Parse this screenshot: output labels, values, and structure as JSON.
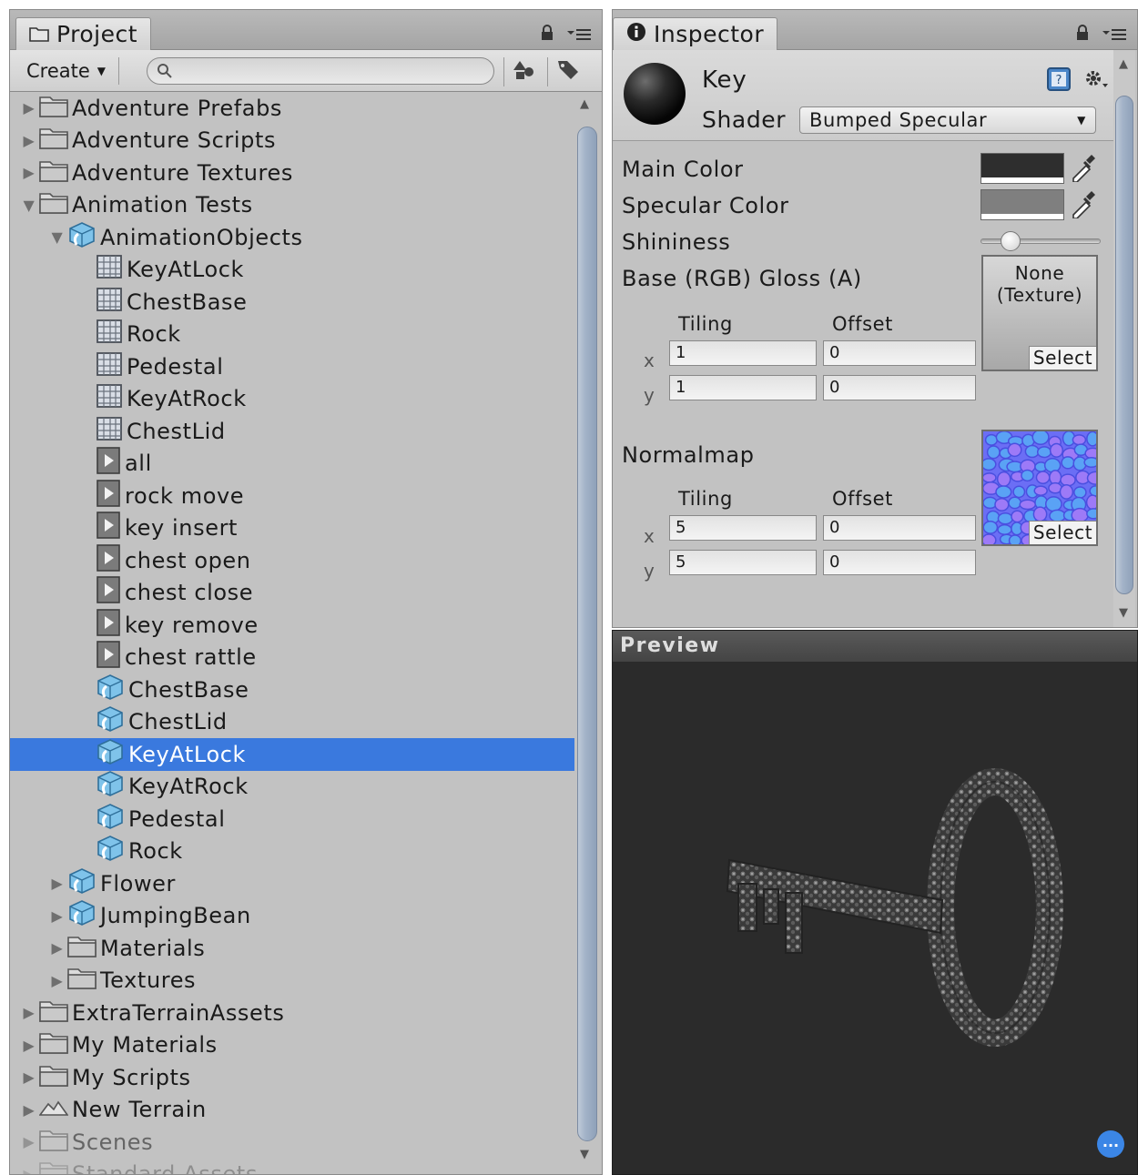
{
  "project": {
    "tab_title": "Project",
    "create_label": "Create",
    "search_placeholder": "",
    "items": [
      {
        "label": "Adventure Prefabs",
        "indent": 0,
        "arrow": "collapsed",
        "icon": "folder-icon"
      },
      {
        "label": "Adventure Scripts",
        "indent": 0,
        "arrow": "collapsed",
        "icon": "folder-icon"
      },
      {
        "label": "Adventure Textures",
        "indent": 0,
        "arrow": "collapsed",
        "icon": "folder-icon"
      },
      {
        "label": "Animation Tests",
        "indent": 0,
        "arrow": "expanded",
        "icon": "folder-icon"
      },
      {
        "label": "AnimationObjects",
        "indent": 1,
        "arrow": "expanded",
        "icon": "model-icon"
      },
      {
        "label": "KeyAtLock",
        "indent": 2,
        "arrow": "none",
        "icon": "mesh-icon"
      },
      {
        "label": "ChestBase",
        "indent": 2,
        "arrow": "none",
        "icon": "mesh-icon"
      },
      {
        "label": "Rock",
        "indent": 2,
        "arrow": "none",
        "icon": "mesh-icon"
      },
      {
        "label": "Pedestal",
        "indent": 2,
        "arrow": "none",
        "icon": "mesh-icon"
      },
      {
        "label": "KeyAtRock",
        "indent": 2,
        "arrow": "none",
        "icon": "mesh-icon"
      },
      {
        "label": "ChestLid",
        "indent": 2,
        "arrow": "none",
        "icon": "mesh-icon"
      },
      {
        "label": "all",
        "indent": 2,
        "arrow": "none",
        "icon": "animation-clip-icon"
      },
      {
        "label": "rock move",
        "indent": 2,
        "arrow": "none",
        "icon": "animation-clip-icon"
      },
      {
        "label": "key insert",
        "indent": 2,
        "arrow": "none",
        "icon": "animation-clip-icon"
      },
      {
        "label": "chest open",
        "indent": 2,
        "arrow": "none",
        "icon": "animation-clip-icon"
      },
      {
        "label": "chest close",
        "indent": 2,
        "arrow": "none",
        "icon": "animation-clip-icon"
      },
      {
        "label": "key remove",
        "indent": 2,
        "arrow": "none",
        "icon": "animation-clip-icon"
      },
      {
        "label": "chest rattle",
        "indent": 2,
        "arrow": "none",
        "icon": "animation-clip-icon"
      },
      {
        "label": "ChestBase",
        "indent": 2,
        "arrow": "none",
        "icon": "model-icon"
      },
      {
        "label": "ChestLid",
        "indent": 2,
        "arrow": "none",
        "icon": "model-icon"
      },
      {
        "label": "KeyAtLock",
        "indent": 2,
        "arrow": "none",
        "icon": "model-icon",
        "selected": true
      },
      {
        "label": "KeyAtRock",
        "indent": 2,
        "arrow": "none",
        "icon": "model-icon"
      },
      {
        "label": "Pedestal",
        "indent": 2,
        "arrow": "none",
        "icon": "model-icon"
      },
      {
        "label": "Rock",
        "indent": 2,
        "arrow": "none",
        "icon": "model-icon"
      },
      {
        "label": "Flower",
        "indent": 1,
        "arrow": "collapsed",
        "icon": "model-icon"
      },
      {
        "label": "JumpingBean",
        "indent": 1,
        "arrow": "collapsed",
        "icon": "model-icon"
      },
      {
        "label": "Materials",
        "indent": 1,
        "arrow": "collapsed",
        "icon": "folder-icon"
      },
      {
        "label": "Textures",
        "indent": 1,
        "arrow": "collapsed",
        "icon": "folder-icon"
      },
      {
        "label": "ExtraTerrainAssets",
        "indent": 0,
        "arrow": "collapsed",
        "icon": "folder-icon"
      },
      {
        "label": "My Materials",
        "indent": 0,
        "arrow": "collapsed",
        "icon": "folder-icon"
      },
      {
        "label": "My Scripts",
        "indent": 0,
        "arrow": "collapsed",
        "icon": "folder-icon"
      },
      {
        "label": "New Terrain",
        "indent": 0,
        "arrow": "collapsed",
        "icon": "terrain-icon"
      },
      {
        "label": "Scenes",
        "indent": 0,
        "arrow": "collapsed",
        "icon": "folder-icon",
        "fade": 1
      },
      {
        "label": "Standard Assets",
        "indent": 0,
        "arrow": "collapsed",
        "icon": "folder-icon",
        "fade": 2
      }
    ]
  },
  "inspector": {
    "tab_title": "Inspector",
    "material_name": "Key",
    "shader_label": "Shader",
    "shader_value": "Bumped Specular",
    "main_color_label": "Main Color",
    "main_color": "#2e2e2e",
    "specular_color_label": "Specular Color",
    "specular_color": "#7f7f7f",
    "shininess_label": "Shininess",
    "shininess_value": 0.25,
    "base_label": "Base (RGB) Gloss (A)",
    "base_texture_text": "None\n(Texture)",
    "base_tiling_x": "1",
    "base_tiling_y": "1",
    "base_offset_x": "0",
    "base_offset_y": "0",
    "normalmap_label": "Normalmap",
    "normal_tiling_x": "5",
    "normal_tiling_y": "5",
    "normal_offset_x": "0",
    "normal_offset_y": "0",
    "tiling_label": "Tiling",
    "offset_label": "Offset",
    "x_label": "x",
    "y_label": "y",
    "select_label": "Select"
  },
  "preview": {
    "title": "Preview",
    "chat_button": "..."
  },
  "colors": {
    "selection": "#3a79de",
    "panel_bg": "#c2c2c2",
    "preview_bg": "#2b2b2b",
    "normalmap": "#6b6ef5"
  }
}
